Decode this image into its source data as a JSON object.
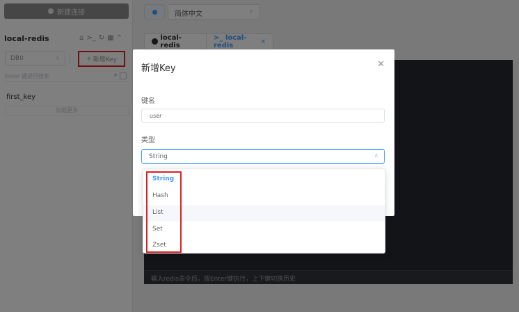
{
  "sidebar": {
    "new_connection_label": "新建连接",
    "connection_name": "local-redis",
    "connection_icons": [
      "home-icon",
      "terminal-icon",
      "refresh-icon",
      "grid-icon",
      "chevron-up-icon"
    ],
    "db_select_value": "DB0",
    "new_key_label": "新增Key",
    "search_placeholder": "Enter 键进行搜索",
    "keys": [
      "first_key"
    ],
    "load_more_label": "加载更多"
  },
  "topbar": {
    "language_value": "简体中文"
  },
  "tabs": [
    {
      "label": "local-redis"
    },
    {
      "label": ">_ local-redis"
    }
  ],
  "terminal": {
    "input_placeholder": "输入redis命令后，按Enter键执行，上下键切换历史"
  },
  "dialog": {
    "title": "新增Key",
    "name_label": "键名",
    "name_value": "user",
    "type_label": "类型",
    "type_value": "String",
    "options": [
      "String",
      "Hash",
      "List",
      "Set",
      "Zset"
    ]
  },
  "colors": {
    "accent": "#409eff",
    "annotation": "#e02020",
    "terminal_bg": "#26292e"
  }
}
